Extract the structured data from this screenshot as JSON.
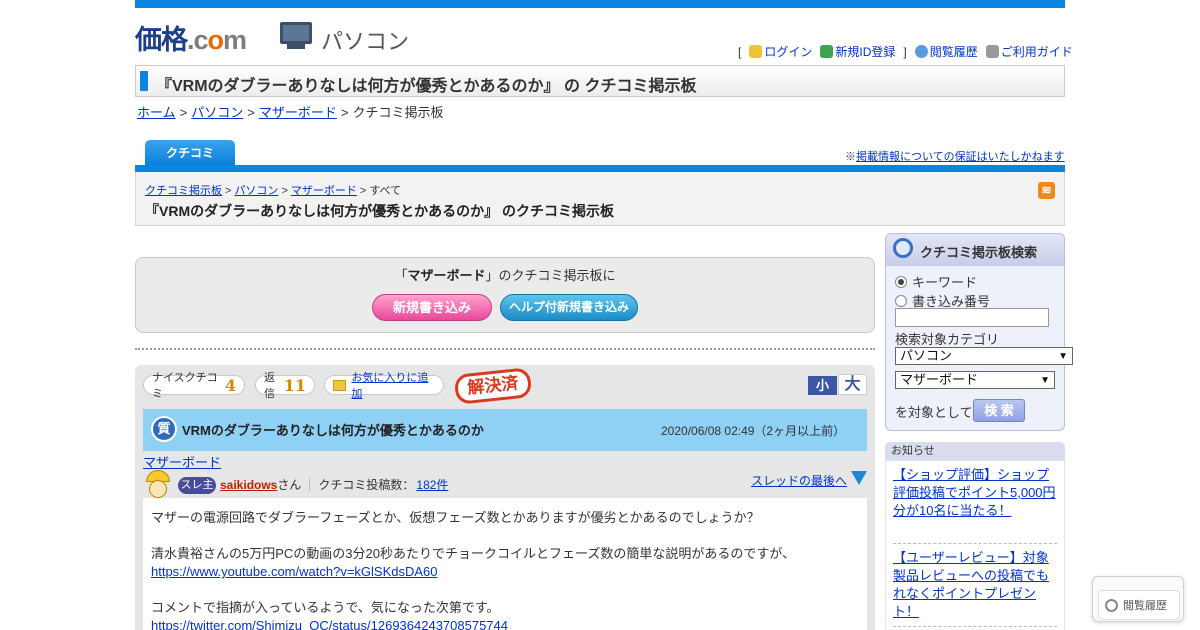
{
  "header": {
    "logo_main": "価格",
    "logo_dotcom_c": ".c",
    "logo_dotcom_o": "o",
    "logo_dotcom_m": "m",
    "category_label": "パソコン",
    "utility": {
      "bracket_open": "[",
      "login": "ログイン",
      "register": "新規ID登録",
      "bracket_close": "]",
      "history": "閲覧履歴",
      "guide": "ご利用ガイド"
    }
  },
  "page_title": "『VRMのダブラーありなしは何方が優秀とかあるのか』 の クチコミ掲示板",
  "breadcrumb": [
    "ホーム",
    "パソコン",
    "マザーボード",
    "クチコミ掲示板"
  ],
  "breadcrumb_sep": ">",
  "tab_label": "クチコミ",
  "disclaimer_prefix": "※",
  "disclaimer_link": "掲載情報についての保証はいたしかねます",
  "sub_breadcrumb": [
    "クチコミ掲示板",
    "パソコン",
    "マザーボード",
    "すべて"
  ],
  "sub_title": "『VRMのダブラーありなしは何方が優秀とかあるのか』 のクチコミ掲示板",
  "rss_label": "RSS",
  "post_box": {
    "prefix": "「",
    "category": "マザーボード",
    "suffix": "」のクチコミ掲示板に",
    "new_post_button": "新規書き込み",
    "help_post_button": "ヘルプ付新規書き込み"
  },
  "thread": {
    "nice_label": "ナイスクチコミ",
    "nice_count": "4",
    "reply_label": "返信",
    "reply_count": "11",
    "favorite_label": "お気に入りに追加",
    "solved_label": "解決済",
    "size_small": "小",
    "size_large": "大",
    "question_icon": "質",
    "title": "VRMのダブラーありなしは何方が優秀とかあるのか",
    "date": "2020/06/08 02:49（2ヶ月以上前）",
    "category_link": "マザーボード",
    "owner_badge": "スレ主",
    "username": "saikidows",
    "honorific": "さん",
    "post_count_label": "クチコミ投稿数：",
    "post_count": "182件",
    "to_end_link": "スレッドの最後へ",
    "body": {
      "line1": "マザーの電源回路でダブラーフェーズとか、仮想フェーズ数とかありますが優劣とかあるのでしょうか？",
      "line2": "清水貴裕さんの5万円PCの動画の3分20秒あたりでチョークコイルとフェーズ数の簡単な説明があるのですが、",
      "link1": "https://www.youtube.com/watch?v=kGlSKdsDA60",
      "line3": "コメントで指摘が入っているようで、気になった次第です。",
      "link2": "https://twitter.com/Shimizu_OC/status/1269364243708575744"
    }
  },
  "sidebar": {
    "search": {
      "title": "クチコミ掲示板検索",
      "radio_keyword": "キーワード",
      "radio_number": "書き込み番号",
      "search_value": "",
      "category_label": "検索対象カテゴリ",
      "select_1": "パソコン",
      "select_2": "マザーボード",
      "target_label": "を対象として",
      "search_button": "検 索"
    },
    "notice": {
      "heading": "お知らせ",
      "item1": "【ショップ評価】ショップ評価投稿でポイント5,000円分が10名に当たる！",
      "item2": "【ユーザーレビュー】対象製品レビューへの投稿でもれなくポイントプレゼント！"
    }
  },
  "history_button": "閲覧履歴",
  "colors": {
    "brand_blue": "#0a86e0",
    "link": "#0033cc",
    "username": "#c41e00",
    "solved": "#d93a1e",
    "question_bar": "#8fd0f5"
  }
}
